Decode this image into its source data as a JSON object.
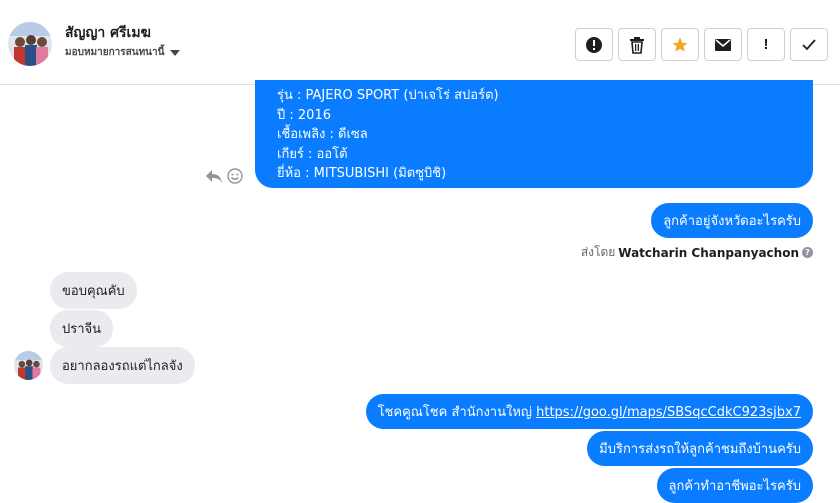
{
  "header": {
    "contact_name": "สัญญา ศรีเมฆ",
    "assign_label": "มอบหมายการสนทนานี้",
    "actions": [
      {
        "icon": "alert-circle-icon"
      },
      {
        "icon": "trash-icon"
      },
      {
        "icon": "star-icon"
      },
      {
        "icon": "envelope-icon"
      },
      {
        "icon": "exclamation-icon",
        "label": "!"
      },
      {
        "icon": "checkmark-icon"
      }
    ]
  },
  "messages": {
    "car_details": [
      "รุ่น : PAJERO SPORT (ปาเจโร่ สปอร์ต)",
      "ปี : 2016",
      "เชื้อเพลิง : ดีเซล",
      "เกียร์ : ออโต้",
      "ยี่ห้อ : MITSUBISHI (มิตซูบิชิ)"
    ],
    "out_1": "ลูกค้าอยู่จังหวัดอะไรครับ",
    "sent_by_prefix": "ส่งโดย",
    "sent_by_name": "Watcharin Chanpanyachon",
    "in_1": "ขอบคุณคับ",
    "in_2": "ปราจีน",
    "in_3": "อยากลองรถแต่ไกลจัง",
    "out_2_text": "โชคคูณโชค สำนักงานใหญ่ ",
    "out_2_link": "https://goo.gl/maps/SBSqcCdkC923sjbx7",
    "out_3": "มีบริการส่งรถให้ลูกค้าชมถึงบ้านครับ",
    "out_4": "ลูกค้าทำอาชีพอะไรครับ"
  },
  "colors": {
    "outgoing_bubble": "#0a7cff",
    "incoming_bubble": "#e9ebee",
    "star": "#f5a623"
  }
}
